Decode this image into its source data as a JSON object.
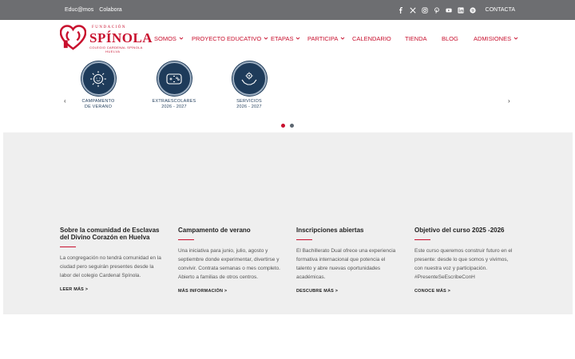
{
  "topbar": {
    "links": [
      "Educ@mos",
      "Colabora"
    ],
    "social_icons": [
      "facebook-icon",
      "x-icon",
      "instagram-icon",
      "pinterest-icon",
      "youtube-icon",
      "linkedin-icon",
      "spotify-icon"
    ],
    "contact_label": "CONTACTA"
  },
  "logo": {
    "fundacion": "FUNDACIÓN",
    "name": "SPÍNOLA",
    "subtitle": "COLEGIO CARDENAL SPÍNOLA",
    "city": "HUELVA"
  },
  "nav": {
    "items": [
      {
        "label": "SOMOS",
        "dropdown": true
      },
      {
        "label": "PROYECTO EDUCATIVO",
        "dropdown": true
      },
      {
        "label": "ETAPAS",
        "dropdown": true
      },
      {
        "label": "PARTICIPA",
        "dropdown": true
      },
      {
        "label": "CALENDARIO",
        "dropdown": false
      },
      {
        "label": "TIENDA",
        "dropdown": false
      },
      {
        "label": "BLOG",
        "dropdown": false
      },
      {
        "label": "ADMISIONES",
        "dropdown": true
      }
    ]
  },
  "carousel": {
    "prev": "‹",
    "next": "›",
    "items": [
      {
        "line1": "CAMPAMENTO",
        "line2": "DE VERANO",
        "icon": "sun-icon"
      },
      {
        "line1": "EXTRAESCOLARES",
        "line2": "2026 - 2027",
        "icon": "gamepad-icon"
      },
      {
        "line1": "SERVICIOS",
        "line2": "2026 - 2027",
        "icon": "hands-gear-icon"
      }
    ],
    "active_dot": 0,
    "dot_count": 2
  },
  "news": [
    {
      "title": "Sobre la comunidad de Esclavas del Divino Corazón en Huelva",
      "body": "La congregación no tendrá comunidad en la ciudad pero seguirán presentes desde la labor del colegio Cardenal Spínola.",
      "link": "LEER MÁS >"
    },
    {
      "title": "Campamento de verano",
      "body": "Una iniciativa para junio, julio, agosto y septiembre donde experimentar, divertirse y convivir. Contrata semanas o mes completo. Abierto a familias de otros centros.",
      "link": "MÁS INFORMACIÓN >"
    },
    {
      "title": "Inscripciones abiertas",
      "body": "El Bachillerato Dual ofrece una experiencia formativa internacional que potencia el talento y abre nuevas oportunidades académicas.",
      "link": "DESCUBRE MÁS >"
    },
    {
      "title": "Objetivo del curso 2025 -2026",
      "body": "Este curso queremos construir futuro en el presente: desde lo que somos y vivimos, con nuestra voz y participación. #PresenteSeEscribeConH",
      "link": "CONOCE MÁS >"
    }
  ],
  "colors": {
    "brand_red": "#c8102e",
    "navy": "#1e3b5a",
    "topbar": "#6d6e71",
    "dot_inactive": "#5c6670"
  }
}
